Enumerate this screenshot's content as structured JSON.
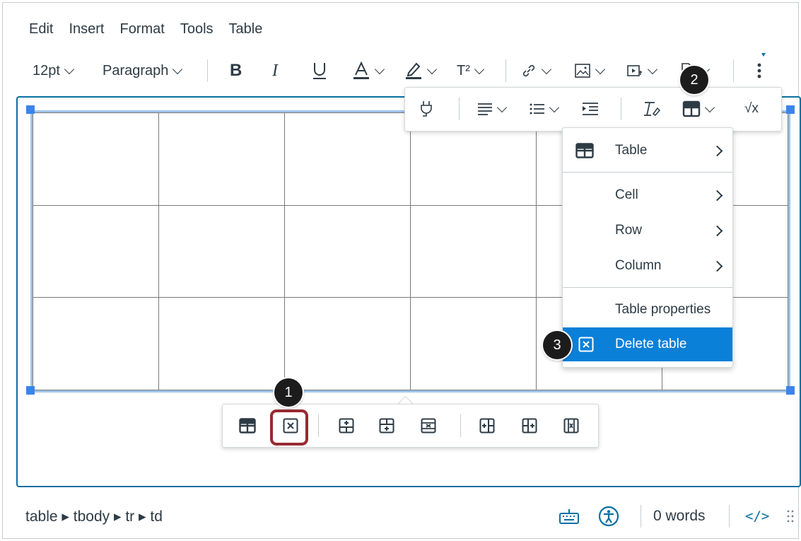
{
  "menubar": {
    "items": [
      "Edit",
      "Insert",
      "Format",
      "Tools",
      "Table"
    ]
  },
  "toolbar": {
    "font_size": "12pt",
    "block_format": "Paragraph",
    "superscript_label": "T²",
    "icons": [
      "bold-icon",
      "italic-icon",
      "underline-icon",
      "text-color-icon",
      "highlight-icon",
      "superscript-icon",
      "link-icon",
      "image-icon",
      "media-icon",
      "document-icon",
      "more-icon"
    ]
  },
  "floating_toolbar": {
    "icons": [
      "apps-plug-icon",
      "align-icon",
      "list-icon",
      "indent-icon",
      "clear-format-icon",
      "table-icon",
      "equation-icon"
    ],
    "equation_label": "√x"
  },
  "table_menu": {
    "items": [
      {
        "label": "Table",
        "has_submenu": true
      },
      {
        "label": "Cell",
        "has_submenu": true
      },
      {
        "label": "Row",
        "has_submenu": true
      },
      {
        "label": "Column",
        "has_submenu": true
      },
      {
        "label": "Table properties",
        "has_submenu": false
      },
      {
        "label": "Delete table",
        "has_submenu": false,
        "active": true
      }
    ]
  },
  "table_grid": {
    "rows": 3,
    "cols": 6
  },
  "context_toolbar": {
    "icons": [
      "table-props-icon",
      "delete-table-icon",
      "insert-row-before-icon",
      "insert-row-after-icon",
      "delete-row-icon",
      "insert-col-before-icon",
      "insert-col-after-icon",
      "delete-col-icon"
    ]
  },
  "callouts": {
    "one": "1",
    "two": "2",
    "three": "3"
  },
  "statusbar": {
    "path": "table ▸ tbody ▸ tr ▸ td",
    "word_count": "0 words",
    "html_toggle": "</>"
  },
  "colors": {
    "accent": "#0770a3",
    "menu_active": "#0b80d8",
    "callout_highlight": "#962a32",
    "text": "#2d3b45"
  }
}
